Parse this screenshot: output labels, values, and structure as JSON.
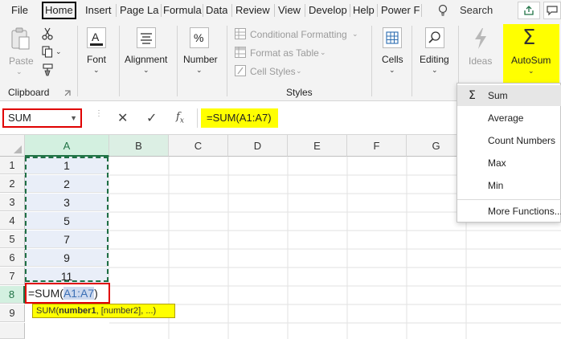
{
  "tabs": [
    {
      "label": "File"
    },
    {
      "label": "Home"
    },
    {
      "label": "Insert"
    },
    {
      "label": "Page La"
    },
    {
      "label": "Formula"
    },
    {
      "label": "Data"
    },
    {
      "label": "Review"
    },
    {
      "label": "View"
    },
    {
      "label": "Develop"
    },
    {
      "label": "Help"
    },
    {
      "label": "Power F"
    }
  ],
  "search": {
    "label": "Search",
    "icon": "lightbulb-icon"
  },
  "ribbon": {
    "clipboard": {
      "paste_label": "Paste",
      "group_label": "Clipboard"
    },
    "font": {
      "label": "Font"
    },
    "alignment": {
      "label": "Alignment"
    },
    "number": {
      "label": "Number"
    },
    "styles": {
      "conditional_formatting": "Conditional Formatting",
      "format_as_table": "Format as Table",
      "cell_styles": "Cell Styles",
      "group_label": "Styles"
    },
    "cells": {
      "label": "Cells"
    },
    "editing": {
      "label": "Editing"
    },
    "ideas": {
      "label": "Ideas"
    },
    "autosum": {
      "label": "AutoSum",
      "highlight": "#ffff00"
    }
  },
  "formula_bar": {
    "name_box": "SUM",
    "formula": "=SUM(A1:A7)"
  },
  "grid": {
    "columns": [
      "A",
      "B",
      "C",
      "D",
      "E",
      "F",
      "G"
    ],
    "rows": [
      "1",
      "2",
      "3",
      "4",
      "5",
      "6",
      "7",
      "8",
      "9"
    ],
    "column_a_values": [
      "1",
      "2",
      "3",
      "5",
      "7",
      "9",
      "11"
    ],
    "edit_cell": {
      "prefix": "=SUM(",
      "ref": "A1:A7",
      "suffix": ")"
    },
    "tooltip": {
      "fn": "SUM(",
      "arg1": "number1",
      "rest": ", [number2], ...)"
    }
  },
  "autosum_menu": {
    "items": [
      "Sum",
      "Average",
      "Count Numbers",
      "Max",
      "Min",
      "More Functions..."
    ],
    "selected": "Sum"
  },
  "colors": {
    "highlight": "#ffff00",
    "error_border": "#e00000",
    "excel_green": "#217346",
    "range_fill": "#e9eef8"
  }
}
